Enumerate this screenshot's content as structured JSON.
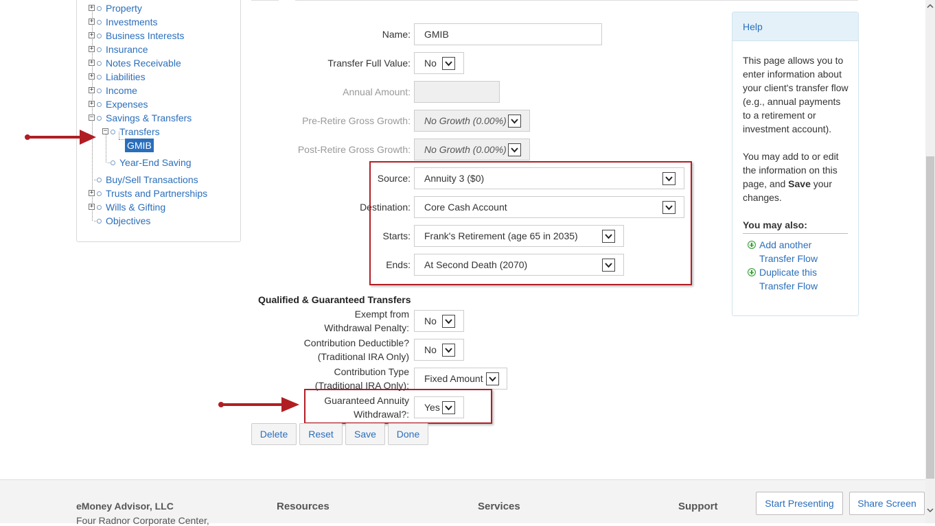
{
  "tree": {
    "items": [
      {
        "label": "Property"
      },
      {
        "label": "Investments"
      },
      {
        "label": "Business Interests"
      },
      {
        "label": "Insurance"
      },
      {
        "label": "Notes Receivable"
      },
      {
        "label": "Liabilities"
      },
      {
        "label": "Income"
      },
      {
        "label": "Expenses"
      },
      {
        "label": "Savings & Transfers"
      },
      {
        "label": "Transfers"
      },
      {
        "label": "GMIB"
      },
      {
        "label": "Year-End Saving"
      },
      {
        "label": "Buy/Sell Transactions"
      },
      {
        "label": "Trusts and Partnerships"
      },
      {
        "label": "Wills & Gifting"
      },
      {
        "label": "Objectives"
      }
    ]
  },
  "form": {
    "name_label": "Name:",
    "name_value": "GMIB",
    "transfer_full_label": "Transfer Full Value:",
    "transfer_full_value": "No",
    "annual_amount_label": "Annual Amount:",
    "annual_amount_value": "",
    "pre_retire_label": "Pre-Retire Gross Growth:",
    "pre_retire_value": "No Growth (0.00%)",
    "post_retire_label": "Post-Retire Gross Growth:",
    "post_retire_value": "No Growth (0.00%)",
    "source_label": "Source:",
    "source_value": "Annuity 3 ($0)",
    "destination_label": "Destination:",
    "destination_value": "Core Cash Account",
    "starts_label": "Starts:",
    "starts_value": "Frank's Retirement (age 65 in 2035)",
    "ends_label": "Ends:",
    "ends_value": "At Second Death (2070)",
    "section_title": "Qualified & Guaranteed Transfers",
    "exempt_label_1": "Exempt from",
    "exempt_label_2": "Withdrawal Penalty:",
    "exempt_value": "No",
    "deductible_label_1": "Contribution Deductible?",
    "deductible_label_2": "(Traditional IRA Only)",
    "deductible_value": "No",
    "contrib_type_label_1": "Contribution Type",
    "contrib_type_label_2": "(Traditional IRA Only):",
    "contrib_type_value": "Fixed Amount",
    "guaranteed_label_1": "Guaranteed Annuity",
    "guaranteed_label_2": "Withdrawal?:",
    "guaranteed_value": "Yes"
  },
  "buttons": {
    "delete": "Delete",
    "reset": "Reset",
    "save": "Save",
    "done": "Done"
  },
  "help": {
    "title": "Help",
    "p1": "This page allows you to enter information about your client's transfer flow (e.g., annual payments to a retirement or investment account).",
    "p2_pre": "You may add to or edit the information on this page, and ",
    "p2_bold": "Save",
    "p2_post": " your changes.",
    "also_title": "You may also:",
    "link1": "Add another Transfer Flow",
    "link2": "Duplicate this Transfer Flow"
  },
  "footer": {
    "company": "eMoney Advisor, LLC",
    "address": "Four Radnor Corporate Center,",
    "resources": "Resources",
    "services": "Services",
    "support": "Support",
    "start_presenting": "Start Presenting",
    "share_screen": "Share Screen"
  },
  "colors": {
    "link": "#2a6ebb",
    "highlight_box": "#b01e24",
    "selected_node": "#2a6ebb"
  }
}
